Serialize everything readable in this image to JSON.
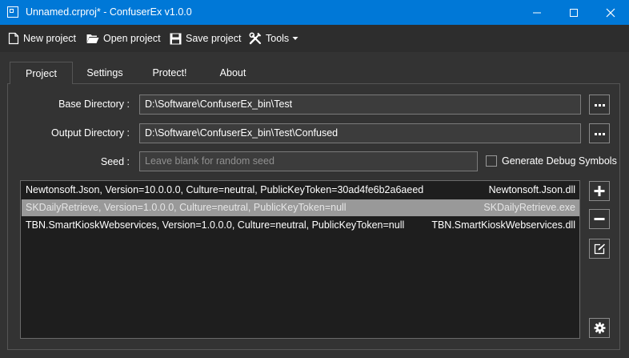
{
  "window": {
    "title": "Unnamed.crproj* - ConfuserEx v1.0.0"
  },
  "toolbar": {
    "new_project": "New project",
    "open_project": "Open project",
    "save_project": "Save project",
    "tools": "Tools"
  },
  "tabs": [
    {
      "label": "Project",
      "active": true
    },
    {
      "label": "Settings",
      "active": false
    },
    {
      "label": "Protect!",
      "active": false
    },
    {
      "label": "About",
      "active": false
    }
  ],
  "project": {
    "base_directory_label": "Base Directory :",
    "base_directory_value": "D:\\Software\\ConfuserEx_bin\\Test",
    "output_directory_label": "Output Directory :",
    "output_directory_value": "D:\\Software\\ConfuserEx_bin\\Test\\Confused",
    "seed_label": "Seed :",
    "seed_value": "",
    "seed_placeholder": "Leave blank for random seed",
    "debug_symbols_label": "Generate Debug Symbols",
    "debug_symbols_checked": false,
    "modules": [
      {
        "name": "Newtonsoft.Json, Version=10.0.0.0, Culture=neutral, PublicKeyToken=30ad4fe6b2a6aeed",
        "file": "Newtonsoft.Json.dll",
        "selected": false
      },
      {
        "name": "SKDailyRetrieve, Version=1.0.0.0, Culture=neutral, PublicKeyToken=null",
        "file": "SKDailyRetrieve.exe",
        "selected": true
      },
      {
        "name": "TBN.SmartKioskWebservices, Version=1.0.0.0, Culture=neutral, PublicKeyToken=null",
        "file": "TBN.SmartKioskWebservices.dll",
        "selected": false
      }
    ]
  },
  "colors": {
    "titlebar": "#0078d7",
    "background": "#333333",
    "list_background": "#1e1e1e",
    "selection": "#999999"
  }
}
